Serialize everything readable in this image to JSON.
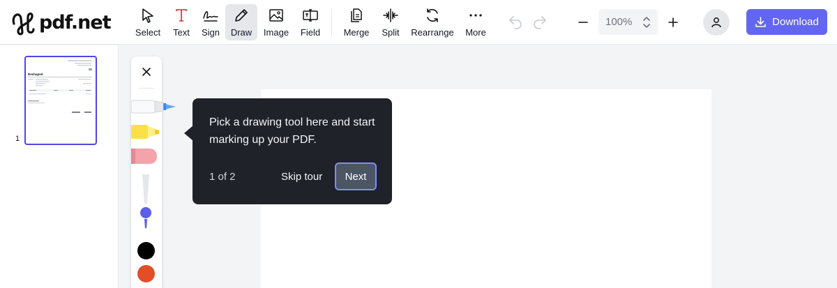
{
  "app": {
    "logo_text": "pdf.net"
  },
  "toolbar": {
    "tools": [
      {
        "label": "Select",
        "icon": "cursor-arrow-icon"
      },
      {
        "label": "Text",
        "icon": "text-t-icon"
      },
      {
        "label": "Sign",
        "icon": "signature-icon"
      },
      {
        "label": "Draw",
        "icon": "pen-icon",
        "active": true
      },
      {
        "label": "Image",
        "icon": "image-icon"
      },
      {
        "label": "Field",
        "icon": "form-field-icon"
      },
      {
        "label": "Merge",
        "icon": "merge-icon"
      },
      {
        "label": "Split",
        "icon": "split-icon"
      },
      {
        "label": "Rearrange",
        "icon": "rearrange-icon"
      },
      {
        "label": "More",
        "icon": "ellipsis-icon"
      }
    ],
    "zoom_value": "100%",
    "download_label": "Download"
  },
  "sidebar": {
    "pages": [
      {
        "number": "1",
        "doc_title": "Reshaped"
      }
    ]
  },
  "palette": {
    "tools": [
      "pen-tool",
      "highlighter-tool",
      "eraser-tool"
    ],
    "colors": [
      "#000000",
      "#e24e26"
    ]
  },
  "tour": {
    "message": "Pick a drawing tool here and start marking up your PDF.",
    "step": "1 of 2",
    "skip_label": "Skip tour",
    "next_label": "Next"
  },
  "colors": {
    "accent": "#6366f1",
    "tooltip_bg": "#1f2229",
    "thumb_border": "#4f46e5"
  }
}
